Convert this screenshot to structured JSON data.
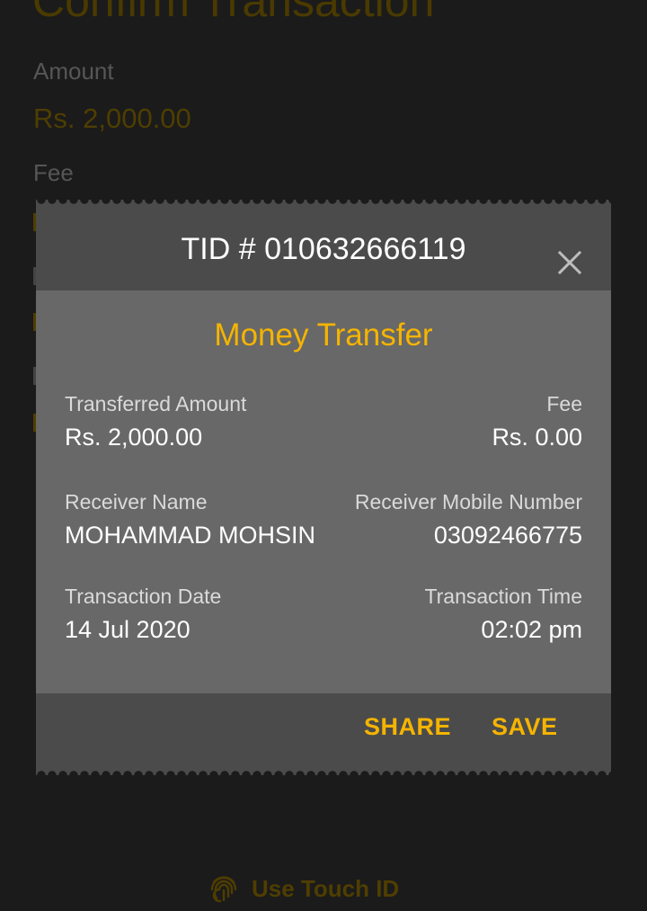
{
  "background": {
    "title": "Confirm Transaction",
    "amount_label": "Amount",
    "amount_value": "Rs. 2,000.00",
    "fee_label": "Fee",
    "touch_id_label": "Use Touch ID",
    "touch_id_icon": "fingerprint-icon"
  },
  "dialog": {
    "tid": "TID # 010632666119",
    "close_icon": "close-icon",
    "heading": "Money Transfer",
    "transferred_amount_label": "Transferred Amount",
    "transferred_amount_value": "Rs. 2,000.00",
    "fee_label": "Fee",
    "fee_value": "Rs. 0.00",
    "receiver_name_label": "Receiver Name",
    "receiver_name_value": "MOHAMMAD MOHSIN",
    "receiver_mobile_label": "Receiver Mobile Number",
    "receiver_mobile_value": "03092466775",
    "transaction_date_label": "Transaction Date",
    "transaction_date_value": "14 Jul 2020",
    "transaction_time_label": "Transaction Time",
    "transaction_time_value": "02:02 pm",
    "share_label": "SHARE",
    "save_label": "SAVE"
  },
  "colors": {
    "accent": "#f5b400",
    "header": "#4b4b4b",
    "body": "#686868",
    "backdrop": "#1b1b1b"
  }
}
